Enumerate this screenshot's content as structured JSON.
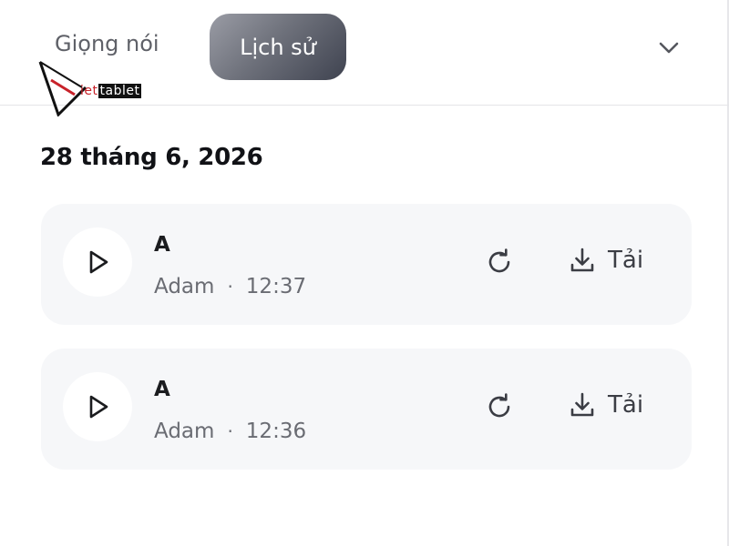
{
  "tabs": {
    "voices_label": "Giọng nói",
    "history_label": "Lịch sử"
  },
  "logo": {
    "letter": "V",
    "part1": "iet",
    "part2": "tablet"
  },
  "history": {
    "date_heading": "28 tháng 6, 2026",
    "items": [
      {
        "title": "A",
        "voice": "Adam",
        "separator": "·",
        "time": "12:37",
        "download_label": "Tải"
      },
      {
        "title": "A",
        "voice": "Adam",
        "separator": "·",
        "time": "12:36",
        "download_label": "Tải"
      }
    ]
  },
  "icons": {
    "play": "play-icon",
    "regenerate": "refresh-icon",
    "download": "download-icon",
    "collapse": "chevron-down-icon"
  },
  "colors": {
    "active_tab_gradient_start": "#9a9ca5",
    "active_tab_gradient_end": "#3f4350",
    "card_background": "#f6f7f9",
    "logo_red": "#c8222a"
  }
}
